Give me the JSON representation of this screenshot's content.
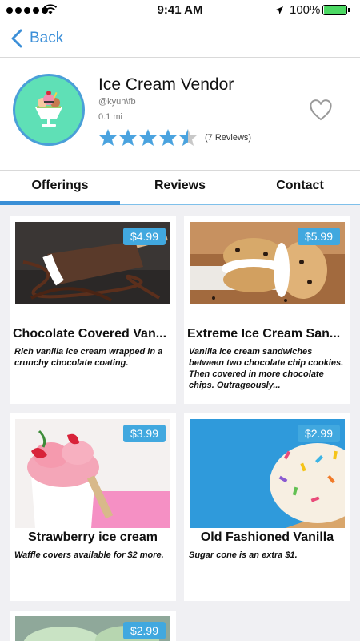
{
  "status_bar": {
    "time": "9:41 AM",
    "battery": "100%"
  },
  "nav": {
    "back_label": "Back"
  },
  "vendor": {
    "name": "Ice Cream Vendor",
    "handle": "@kyun\\fb",
    "distance": "0.1 mi",
    "rating": 4.5,
    "reviews_label": "(7 Reviews)"
  },
  "tabs": [
    {
      "label": "Offerings",
      "active": true
    },
    {
      "label": "Reviews",
      "active": false
    },
    {
      "label": "Contact",
      "active": false
    }
  ],
  "offerings": [
    {
      "title": "Chocolate Covered Van...",
      "price": "$4.99",
      "description": "Rich vanilla ice cream wrapped in a crunchy chocolate coating."
    },
    {
      "title": "Extreme Ice Cream San...",
      "price": "$5.99",
      "description": "Vanilla ice cream sandwiches between two chocolate chip cookies. Then covered in more chocolate chips. Outrageously..."
    },
    {
      "title": "Strawberry ice cream",
      "price": "$3.99",
      "description": "Waffle covers available for $2 more."
    },
    {
      "title": "Old Fashioned Vanilla",
      "price": "$2.99",
      "description": "Sugar cone is an extra $1."
    },
    {
      "title": "",
      "price": "$2.99",
      "description": ""
    }
  ],
  "colors": {
    "accent": "#3c8fd8",
    "price_badge": "#41a8df",
    "star": "#4aa3df",
    "avatar_bg": "#5fe0b6"
  }
}
